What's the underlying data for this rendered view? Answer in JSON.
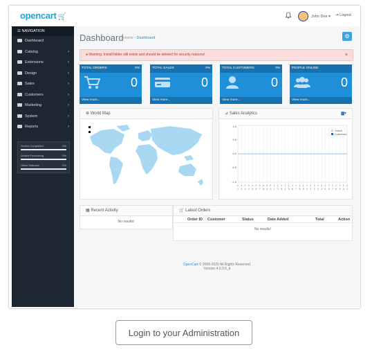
{
  "brand": {
    "logo_text": "opencart"
  },
  "topbar": {
    "user_name": "John Doe ▾",
    "logout_label": "Logout"
  },
  "sidebar": {
    "header": "NAVIGATION",
    "items": [
      {
        "label": "Dashboard",
        "chevron": false
      },
      {
        "label": "Catalog",
        "chevron": true
      },
      {
        "label": "Extensions",
        "chevron": true
      },
      {
        "label": "Design",
        "chevron": true
      },
      {
        "label": "Sales",
        "chevron": true
      },
      {
        "label": "Customers",
        "chevron": true
      },
      {
        "label": "Marketing",
        "chevron": true
      },
      {
        "label": "System",
        "chevron": true
      },
      {
        "label": "Reports",
        "chevron": true
      }
    ],
    "progress": [
      {
        "label": "Orders Completed",
        "percent": "0%"
      },
      {
        "label": "Orders Processing",
        "percent": "0%"
      },
      {
        "label": "Other Statuses",
        "percent": "0%"
      }
    ]
  },
  "main": {
    "title": "Dashboard",
    "breadcrumb": {
      "home": "Home",
      "sep": "›",
      "current": "Dashboard"
    },
    "alert": "Warning: Install folder still exists and should be deleted for security reasons!",
    "tiles": [
      {
        "title": "TOTAL ORDERS",
        "percent": "0%",
        "value": "0",
        "link": "View more..."
      },
      {
        "title": "TOTAL SALES",
        "percent": "0%",
        "value": "0",
        "link": "View more..."
      },
      {
        "title": "TOTAL CUSTOMERS",
        "percent": "0%",
        "value": "0",
        "link": "View more..."
      },
      {
        "title": "PEOPLE ONLINE",
        "percent": "",
        "value": "0",
        "link": "View more..."
      }
    ],
    "world_map": {
      "title": "World Map"
    },
    "sales_analytics": {
      "title": "Sales Analytics",
      "legend": [
        "Orders",
        "Customers"
      ],
      "y_ticks": [
        "1.0",
        "0.5",
        "0.0",
        "-0.5",
        "-1.0"
      ]
    },
    "recent_activity": {
      "title": "Recent Activity",
      "empty": "No results!"
    },
    "latest_orders": {
      "title": "Latest Orders",
      "columns": [
        "Order ID",
        "Customer",
        "Status",
        "Date Added",
        "Total",
        "Action"
      ],
      "empty": "No results!"
    },
    "footer": {
      "link": "OpenCart",
      "copyright": "© 2009-2020 All Rights Reserved.",
      "version": "Version 4.0.0.0_b"
    }
  },
  "login_button": "Login to your Administration",
  "colors": {
    "tile_blue": "#1f8fd9",
    "tile_dark": "#1671b0",
    "sidebar": "#1d2731",
    "accent": "#23a1d1"
  }
}
